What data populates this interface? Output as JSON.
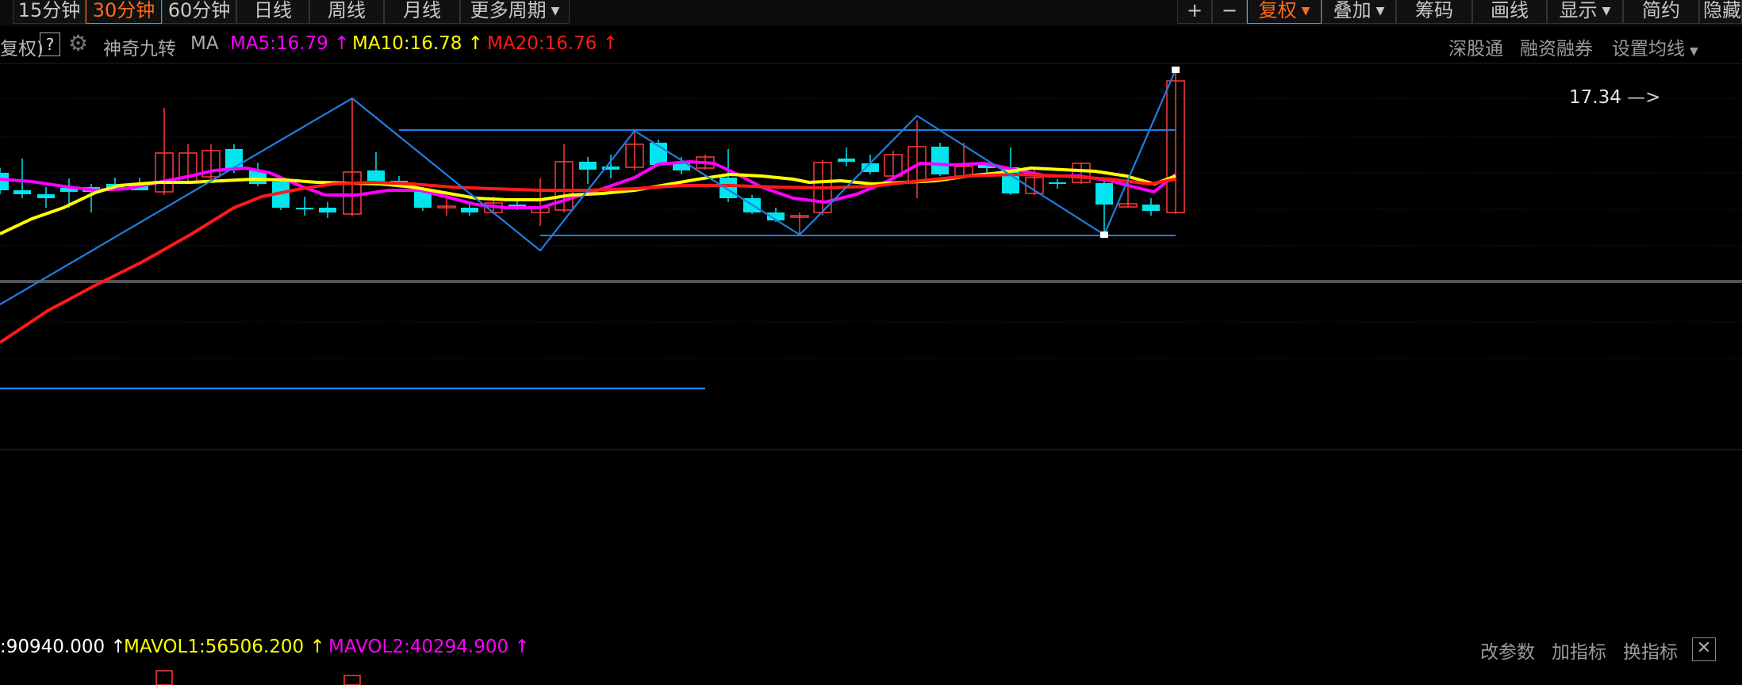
{
  "toolbar": {
    "periods": [
      {
        "label": "15分钟",
        "active": false
      },
      {
        "label": "30分钟",
        "active": true
      },
      {
        "label": "60分钟",
        "active": false
      },
      {
        "label": "日线",
        "active": false
      },
      {
        "label": "周线",
        "active": false
      },
      {
        "label": "月线",
        "active": false
      },
      {
        "label": "更多周期",
        "active": false
      }
    ],
    "right": [
      {
        "label": "+",
        "active": false
      },
      {
        "label": "−",
        "active": false
      },
      {
        "label": "复权",
        "active": true
      },
      {
        "label": "叠加",
        "active": false
      },
      {
        "label": "筹码",
        "active": false
      },
      {
        "label": "画线",
        "active": false
      },
      {
        "label": "显示",
        "active": false
      },
      {
        "label": "简约",
        "active": false
      },
      {
        "label": "隐藏",
        "active": false
      }
    ]
  },
  "info": {
    "fq_label": "复权)",
    "help": "?",
    "indicator_name": "神奇九转",
    "ma_label": "MA",
    "ma5": "MA5:16.79",
    "ma10": "MA10:16.78",
    "ma20": "MA20:16.76",
    "arrow": "↑",
    "links": [
      "深股通",
      "融资融券",
      "设置均线"
    ]
  },
  "price_label": "17.34",
  "volume": {
    "vol": ":90940.000",
    "mavol1": "MAVOL1:56506.200",
    "mavol2": "MAVOL2:40294.900",
    "arrow": "↑",
    "links": [
      "改参数",
      "加指标",
      "换指标"
    ],
    "close": "✕"
  },
  "colors": {
    "up": "#ff3b3b",
    "down": "#00e5ee",
    "ma5": "#ff00ff",
    "ma10": "#ffff00",
    "ma20": "#ff1a1a",
    "drawline": "#1e7fe0",
    "accent": "#ff6a1a"
  }
}
